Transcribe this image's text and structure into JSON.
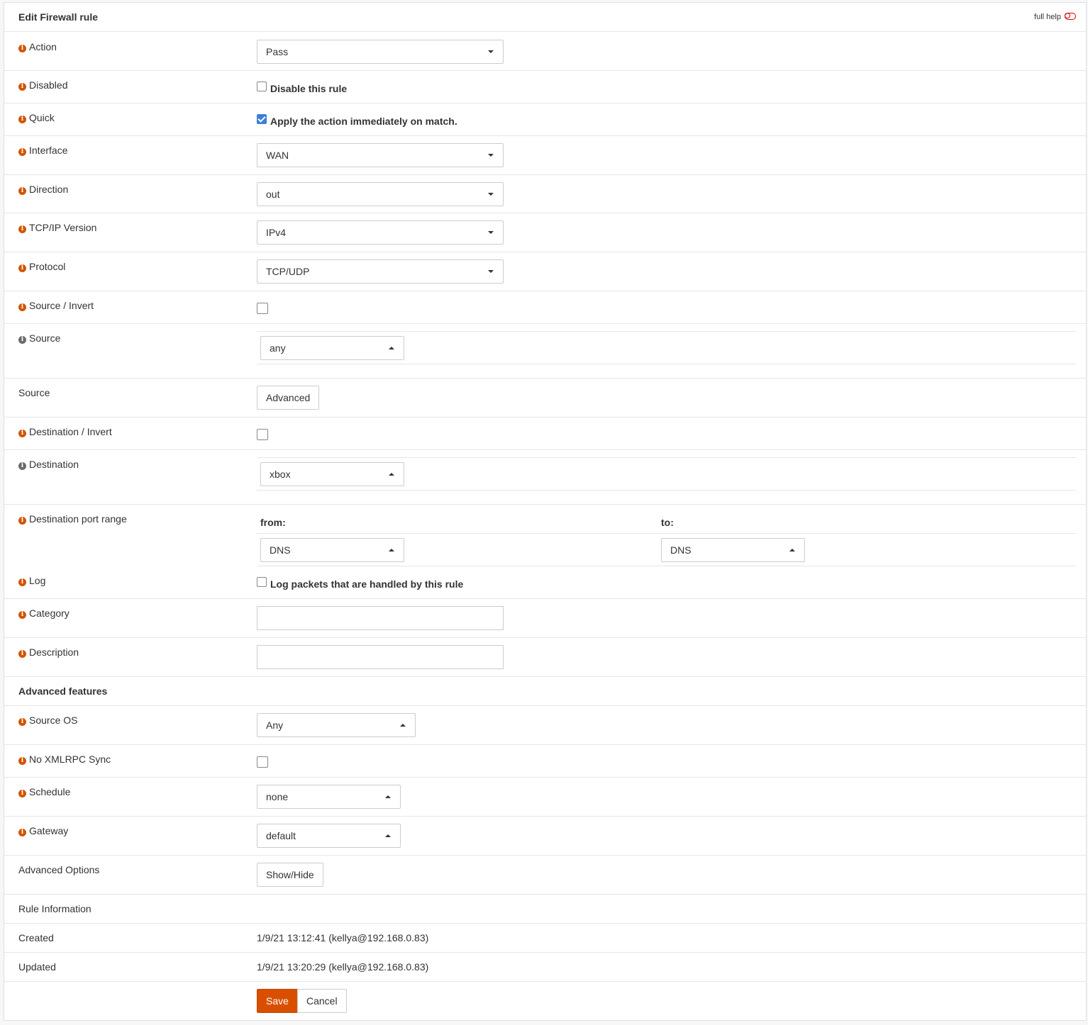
{
  "header": {
    "title": "Edit Firewall rule",
    "full_help": "full help"
  },
  "fields": {
    "action": {
      "label": "Action",
      "value": "Pass"
    },
    "disabled": {
      "label": "Disabled",
      "text": "Disable this rule",
      "checked": false
    },
    "quick": {
      "label": "Quick",
      "text": "Apply the action immediately on match.",
      "checked": true
    },
    "interface": {
      "label": "Interface",
      "value": "WAN"
    },
    "direction": {
      "label": "Direction",
      "value": "out"
    },
    "ipversion": {
      "label": "TCP/IP Version",
      "value": "IPv4"
    },
    "protocol": {
      "label": "Protocol",
      "value": "TCP/UDP"
    },
    "source_invert": {
      "label": "Source / Invert",
      "checked": false
    },
    "source": {
      "label": "Source",
      "value": "any"
    },
    "source_adv": {
      "label": "Source",
      "button": "Advanced"
    },
    "dest_invert": {
      "label": "Destination / Invert",
      "checked": false
    },
    "destination": {
      "label": "Destination",
      "value": "xbox"
    },
    "dest_port": {
      "label": "Destination port range",
      "from_label": "from:",
      "to_label": "to:",
      "from_value": "DNS",
      "to_value": "DNS"
    },
    "log": {
      "label": "Log",
      "text": "Log packets that are handled by this rule",
      "checked": false
    },
    "category": {
      "label": "Category",
      "value": ""
    },
    "description": {
      "label": "Description",
      "value": ""
    }
  },
  "advanced": {
    "heading": "Advanced features",
    "source_os": {
      "label": "Source OS",
      "value": "Any"
    },
    "no_xmlrpc": {
      "label": "No XMLRPC Sync",
      "checked": false
    },
    "schedule": {
      "label": "Schedule",
      "value": "none"
    },
    "gateway": {
      "label": "Gateway",
      "value": "default"
    },
    "advanced_options": {
      "label": "Advanced Options",
      "button": "Show/Hide"
    }
  },
  "rule_info": {
    "heading": "Rule Information",
    "created_label": "Created",
    "created_value": "1/9/21 13:12:41 (kellya@192.168.0.83)",
    "updated_label": "Updated",
    "updated_value": "1/9/21 13:20:29 (kellya@192.168.0.83)"
  },
  "buttons": {
    "save": "Save",
    "cancel": "Cancel"
  },
  "colors": {
    "accent": "#d94f00",
    "checkbox": "#3c7fd9",
    "info_icon": "#d35400"
  }
}
